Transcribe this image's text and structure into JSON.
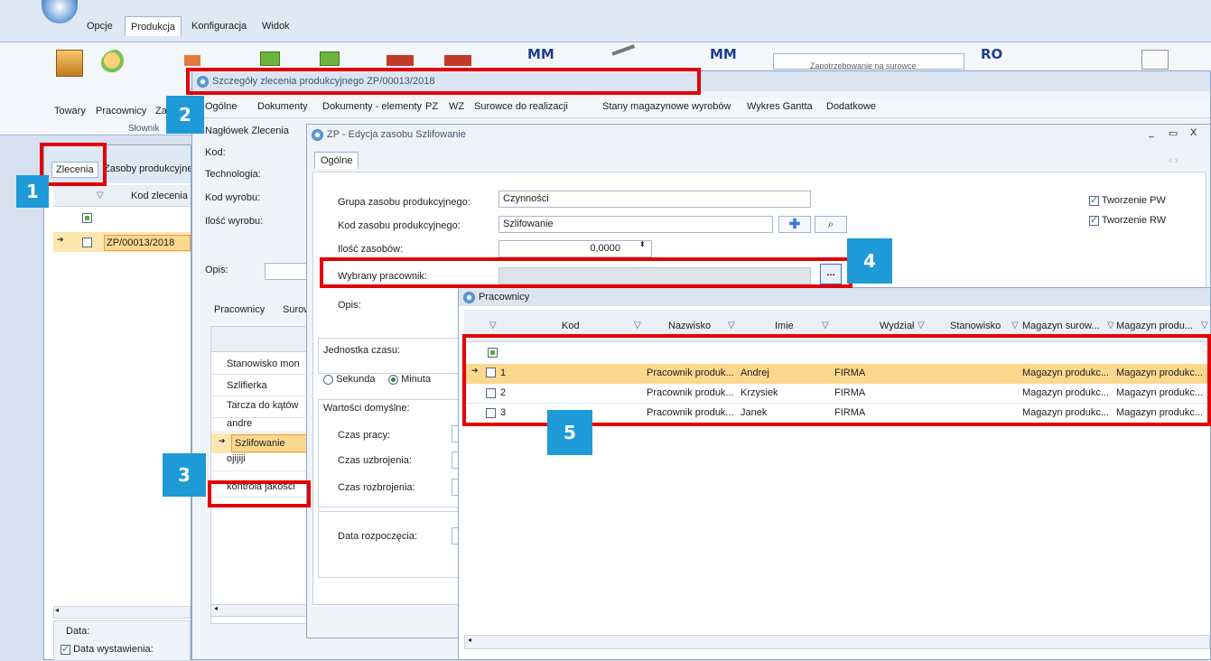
{
  "ribbon_tabs": [
    "Opcje",
    "Produkcja",
    "Konfiguracja",
    "Widok"
  ],
  "ribbon": {
    "buttons": [
      "Towary",
      "Pracownicy",
      "Za"
    ],
    "group_title": "Słownik",
    "mm_labels": [
      "MM",
      "MM",
      "RO"
    ],
    "truncated_button": "Zapotrzebowanie na surowce"
  },
  "left_panel": {
    "tabs": [
      "Zlecenia",
      "Zasoby produkcyjne"
    ],
    "column_kod": "Kod zlecenia",
    "row_value": "ZP/00013/2018",
    "data_label": "Data:",
    "data_wystawienia": "Data wystawienia:"
  },
  "details_window": {
    "title": "Szczegóły zlecenia produkcyjnego ZP/00013/2018",
    "tabs": [
      "Ogólne",
      "Dokumenty",
      "Dokumenty - elementy",
      "PZ",
      "WZ",
      "Surowce do realizacji",
      "Stany magazynowe wyrobów",
      "Wykres Gantta",
      "Dodatkowe"
    ],
    "header_group": "Nagłówek Zlecenia",
    "fields": [
      "Kod:",
      "Technologia:",
      "Kod wyrobu:",
      "Ilość wyrobu:",
      "Opis:"
    ],
    "lower_tabs": [
      "Pracownicy",
      "Surow"
    ],
    "resources": [
      "Stanowisko mon",
      "Szlifierka",
      "Tarcza do kątów",
      "andre",
      "Szlifowanie",
      "ojijiji",
      "kontrola jakości"
    ]
  },
  "edit_window": {
    "title": "ZP - Edycja zasobu Szlifowanie",
    "tab": "Ogólne",
    "grupa_label": "Grupa zasobu produkcyjnego:",
    "grupa_value": "Czynności",
    "kod_label": "Kod zasobu produkcyjnego:",
    "kod_value": "Szlifowanie",
    "ilosc_label": "Ilość zasobów:",
    "ilosc_value": "0,0000",
    "pracownik_label": "Wybrany pracownik:",
    "opis_label": "Opis:",
    "tworzenie_pw": "Tworzenie PW",
    "tworzenie_rw": "Tworzenie RW",
    "jednostka_label": "Jednostka czasu:",
    "sekunda": "Sekunda",
    "minuta": "Minuta",
    "wartosci_label": "Wartości domyślne:",
    "czas_pracy": "Czas pracy:",
    "czas_uzbrojenia": "Czas uzbrojenia:",
    "czas_rozbrojenia": "Czas rozbrojenia:",
    "data_rozpoczecia": "Data rozpoczęcia:",
    "dots": "...",
    "win_controls": [
      "_",
      "▭",
      "X"
    ]
  },
  "pracownicy_window": {
    "title": "Pracownicy",
    "columns": [
      "Kod",
      "Nazwisko",
      "Imie",
      "Wydział",
      "Stanowisko",
      "Magazyn surow...",
      "Magazyn produ..."
    ],
    "rows": [
      [
        "1",
        "Pracownik produk...",
        "Andrej",
        "FIRMA",
        "",
        "Magazyn produkc...",
        "Magazyn produkc..."
      ],
      [
        "2",
        "Pracownik produk...",
        "Krzysiek",
        "FIRMA",
        "",
        "Magazyn produkc...",
        "Magazyn produkc..."
      ],
      [
        "3",
        "Pracownik produk...",
        "Janek",
        "FIRMA",
        "",
        "Magazyn produkc...",
        "Magazyn produkc..."
      ]
    ]
  },
  "callouts": [
    "1",
    "2",
    "3",
    "4",
    "5"
  ],
  "colors": {
    "highlight": "#e30000",
    "callout": "#1e9ad6",
    "selected_row": "#fbd88d"
  }
}
